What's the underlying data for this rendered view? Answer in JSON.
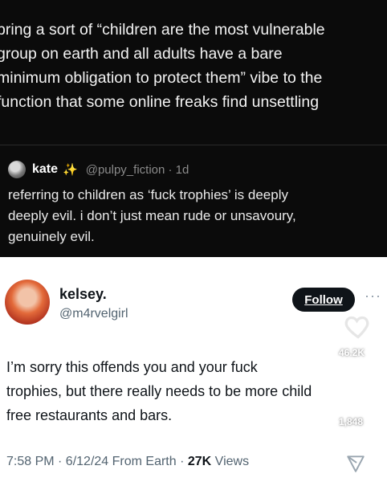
{
  "top_text": "bring a sort of “children are the most vulnerable\ngroup on earth and all adults have a bare\nminimum obligation to protect them” vibe to the\nfunction that some online freaks find unsettling",
  "quoted": {
    "name": "kate",
    "emoji": "✨",
    "handle_time": "@pulpy_fiction · 1d",
    "text": "referring to children as ‘fuck trophies’ is deeply\ndeeply evil. i don’t just mean rude or unsavoury,\ngenuinely evil."
  },
  "tweet": {
    "name": "kelsey.",
    "handle": "@m4rvelgirl",
    "follow_label": "Follow",
    "more_label": "···",
    "likes": "46.2K",
    "replies": "1,848",
    "text": "I’m sorry this offends you and your fuck\ntrophies, but there really needs to be more child\nfree restaurants and bars.",
    "time_date": "7:58 PM · 6/12/24 From Earth · ",
    "views_count": "27K",
    "views_label": " Views"
  }
}
